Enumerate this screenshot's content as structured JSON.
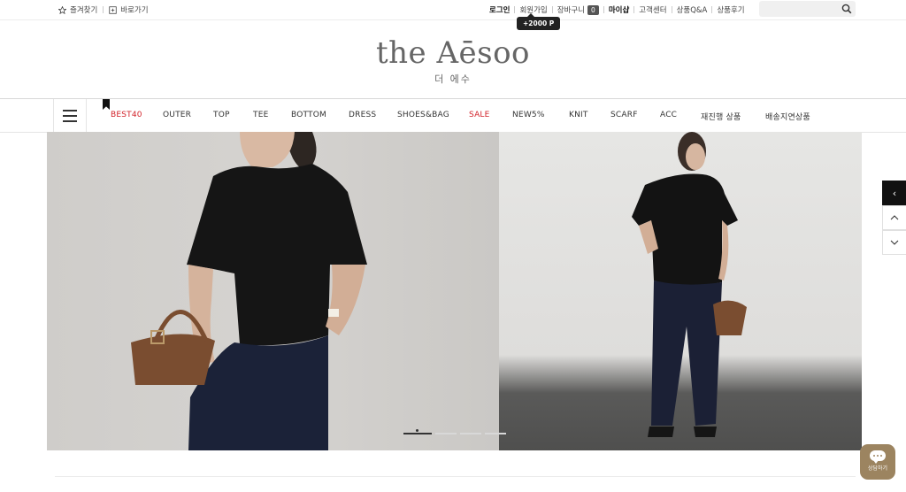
{
  "topbar": {
    "bookmark_label": "즐겨찾기",
    "shortcut_label": "바로가기",
    "login_label": "로그인",
    "join_label": "회원가입",
    "cart_label": "장바구니",
    "cart_count": "0",
    "mypage_label": "마이샵",
    "cs_label": "고객센터",
    "qna_label": "상품Q&A",
    "review_label": "상품후기",
    "search_placeholder": ""
  },
  "tooltip": {
    "text": "+2000 P"
  },
  "logo": {
    "main": "the Aēsoo",
    "sub": "더 에수"
  },
  "nav": {
    "items": [
      {
        "label": "BEST40"
      },
      {
        "label": "OUTER"
      },
      {
        "label": "TOP"
      },
      {
        "label": "TEE"
      },
      {
        "label": "BOTTOM"
      },
      {
        "label": "DRESS"
      },
      {
        "label": "SHOES&BAG"
      },
      {
        "label": "SALE"
      },
      {
        "label": "NEW5%"
      },
      {
        "label": "KNIT"
      },
      {
        "label": "SCARF"
      },
      {
        "label": "ACC"
      },
      {
        "label": "재진행 상품"
      },
      {
        "label": "배송지연상품"
      }
    ],
    "accent_color": "#d2232a"
  },
  "side": {
    "prev_icon": "chevron-left-icon",
    "up_icon": "chevron-up-icon",
    "down_icon": "chevron-down-icon"
  },
  "chat": {
    "label": "상담하기",
    "color": "#9c8460"
  },
  "banner": {
    "slide_count": 5,
    "active_slide": 1
  }
}
